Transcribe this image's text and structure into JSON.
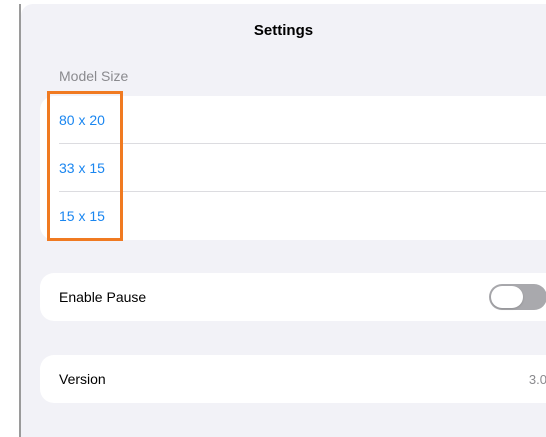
{
  "window": {
    "title": "Settings"
  },
  "model_size": {
    "header": "Model Size",
    "options": [
      {
        "label": "80 x 20"
      },
      {
        "label": "33 x 15"
      },
      {
        "label": "15 x 15"
      }
    ]
  },
  "pause": {
    "label": "Enable Pause",
    "enabled": false
  },
  "version": {
    "label": "Version",
    "value": "3.0"
  },
  "colors": {
    "accent": "#1a86f0",
    "highlight": "#f07a21",
    "background": "#f2f2f7",
    "toggle_off": "#a9a9ad"
  }
}
